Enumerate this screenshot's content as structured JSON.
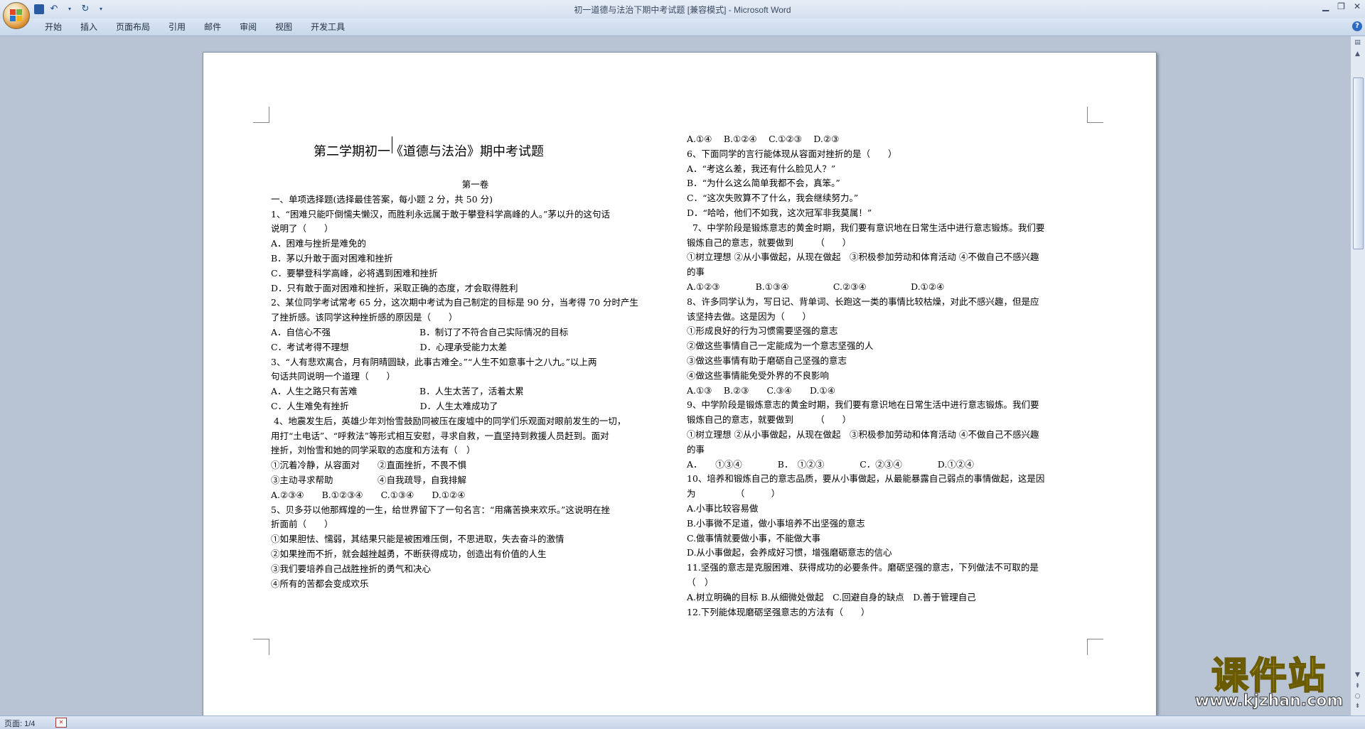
{
  "window": {
    "title": "初一道德与法治下期中考试题 [兼容模式] - Microsoft Word"
  },
  "ribbon": {
    "tabs": [
      "开始",
      "插入",
      "页面布局",
      "引用",
      "邮件",
      "审阅",
      "视图",
      "开发工具"
    ]
  },
  "status_bar": {
    "page": "页面: 1/4"
  },
  "watermark": {
    "title": "课件站",
    "url": "www.kjzhan.com"
  },
  "document": {
    "title": "第二学期初一《道德与法治》期中考试题",
    "section": "第一卷",
    "left_lines": [
      "一、单项选择题(选择最佳答案，每小题 2 分，共 50 分)",
      "1、“困难只能吓倒懦夫懒汉，而胜利永远属于敢于攀登科学高峰的人。”茅以升的这句话",
      "说明了（　　）",
      "A．困难与挫折是难免的",
      "B．茅以升敢于面对困难和挫折",
      "C．要攀登科学高峰，必将遇到困难和挫折",
      "D．只有敢于面对困难和挫折，采取正确的态度，才会取得胜利",
      "2、某位同学考试常考 65 分，这次期中考试为自己制定的目标是 90 分，当考得 70 分时产生",
      "了挫折感。该同学这种挫折感的原因是（　　）",
      "A．自信心不强　　　　　　　　　　B．制订了不符合自己实际情况的目标",
      "C．考试考得不理想　　　　　　　　D．心理承受能力太差",
      "3、“人有悲欢离合，月有阴晴圆缺，此事古难全。”“人生不如意事十之八九。”以上两",
      "句话共同说明一个道理（　　）",
      "A．人生之路只有苦难　　　　　　　B．人生太苦了，活着太累",
      "C．人生难免有挫折　　　　　　　　D．人生太难成功了",
      " 4、地震发生后，英雄少年刘怡雪鼓励同被压在废墟中的同学们乐观面对眼前发生的一切，",
      "用打“土电话”、“呼救法”等形式相互安慰，寻求自救，一直坚持到救援人员赶到。面对",
      "挫折，刘怡雪和她的同学采取的态度和方法有（　）",
      "①沉着冷静，从容面对　　②直面挫折，不畏不惧",
      "③主动寻求帮助　　　　　④自我疏导，自我排解",
      "A.②③④　　B.①②③④　　C.①③④　　D.①②④",
      "5、贝多芬以他那辉煌的一生，给世界留下了一句名言：“用痛苦换来欢乐。”这说明在挫",
      "折面前（　　）",
      "①如果胆怯、懦弱，其结果只能是被困难压倒，不思进取，失去奋斗的激情",
      "②如果挫而不折，就会越挫越勇，不断获得成功，创造出有价值的人生",
      "③我们要培养自己战胜挫折的勇气和决心",
      "④所有的苦都会变成欢乐"
    ],
    "right_lines": [
      "A.①④　 B.①②④　 C.①②③　 D.②③",
      "6、下面同学的言行能体现从容面对挫折的是（　　）",
      "A．“考这么差，我还有什么脸见人？”",
      "B．“为什么这么简单我都不会，真笨。”",
      "C．“这次失败算不了什么，我会继续努力。”",
      "D．“哈哈，他们不如我，这次冠军非我莫属！”",
      "  7、中学阶段是锻炼意志的黄金时期，我们要有意识地在日常生活中进行意志锻炼。我们要",
      "锻炼自己的意志，就要做到　　　（　　）",
      "①树立理想 ②从小事做起，从现在做起　③积极参加劳动和体育活动 ④不做自己不感兴趣",
      "的事",
      "A.①②③　　　　B.①③④　　　　　C.②③④　　　　　D.①②④",
      "8、许多同学认为，写日记、背单词、长跑这一类的事情比较枯燥，对此不感兴趣，但是应",
      "该坚持去做。这是因为（　　）",
      "①形成良好的行为习惯需要坚强的意志",
      "②做这些事情自己一定能成为一个意志坚强的人",
      "③做这些事情有助于磨砺自己坚强的意志",
      "④做这些事情能免受外界的不良影响",
      "A.①③　 B.②③　　C.③④　　D.①④",
      "9、中学阶段是锻炼意志的黄金时期，我们要有意识地在日常生活中进行意志锻炼。我们要",
      "锻炼自己的意志，就要做到　　　（　　）",
      "①树立理想 ②从小事做起，从现在做起　③积极参加劳动和体育活动 ④不做自己不感兴趣",
      "的事",
      "A．　　①③④　　　　B．　①②③　　　　C．②③④　　　　D.①②④",
      "10、培养和锻炼自己的意志品质，要从小事做起，从最能暴露自己弱点的事情做起，这是因",
      "为　　　　　（　　　）",
      "A.小事比较容易做",
      "B.小事微不足道，做小事培养不出坚强的意志",
      "C.做事情就要做小事，不能做大事",
      "D.从小事做起，会养成好习惯，增强磨砺意志的信心",
      "11.坚强的意志是克服困难、获得成功的必要条件。磨砺坚强的意志，下列做法不可取的是",
      "（　）",
      "A.树立明确的目标 B.从细微处做起　C.回避自身的缺点　D.善于管理自己",
      "12.下列能体现磨砺坚强意志的方法有（　　）"
    ]
  }
}
